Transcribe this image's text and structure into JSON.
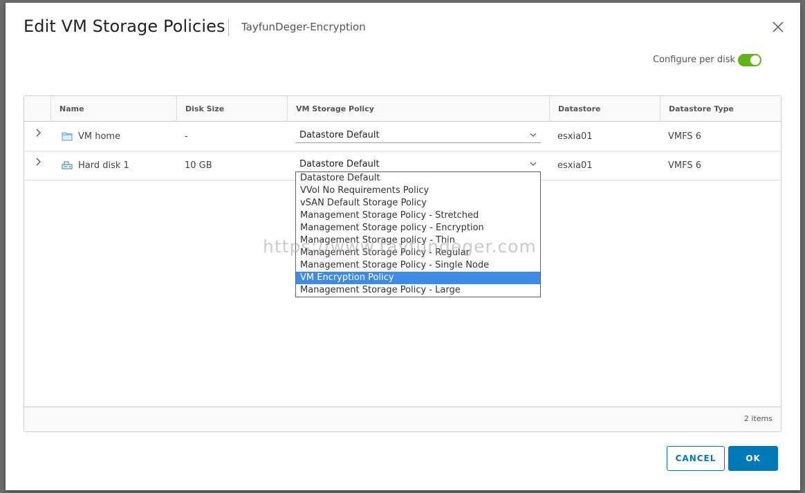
{
  "dialog": {
    "title": "Edit VM Storage Policies",
    "subtitle": "TayfunDeger-Encryption",
    "configure_label": "Configure per disk",
    "configure_enabled": true
  },
  "grid": {
    "columns": [
      "Name",
      "Disk Size",
      "VM Storage Policy",
      "Datastore",
      "Datastore Type"
    ],
    "rows": [
      {
        "name": "VM home",
        "disk_size": "-",
        "policy": "Datastore Default",
        "datastore": "esxia01",
        "datastore_type": "VMFS 6",
        "icon": "folder-icon"
      },
      {
        "name": "Hard disk 1",
        "disk_size": "10 GB",
        "policy": "Datastore Default",
        "datastore": "esxia01",
        "datastore_type": "VMFS 6",
        "icon": "hard-disk-icon"
      }
    ],
    "footer_count": "2 items"
  },
  "dropdown": {
    "options": [
      "Datastore Default",
      "VVol No Requirements Policy",
      "vSAN Default Storage Policy",
      "Management Storage Policy - Stretched",
      "Management Storage policy - Encryption",
      "Management Storage policy - Thin",
      "Management Storage Policy - Regular",
      "Management Storage Policy - Single Node",
      "VM Encryption Policy",
      "Management Storage Policy - Large"
    ],
    "highlighted": "VM Encryption Policy"
  },
  "watermark": "https://www.tayfundeger.com",
  "buttons": {
    "cancel": "CANCEL",
    "ok": "OK"
  },
  "colors": {
    "accent": "#0079b8",
    "toggle_on": "#60b515",
    "highlight": "#3d8be5"
  }
}
